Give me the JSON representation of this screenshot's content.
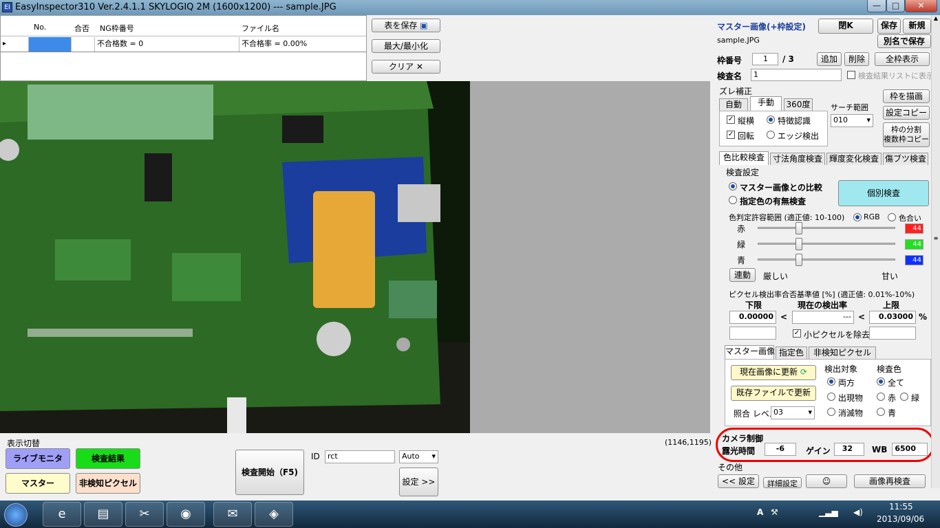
{
  "window": {
    "title": "EasyInspector310 Ver.2.4.1.1 SKYLOGIQ 2M    (1600x1200) --- sample.JPG",
    "icon_text": "EI",
    "minimize": "—",
    "maximize": "□",
    "close": "✕"
  },
  "grid": {
    "headers": [
      "No.",
      "合否",
      "NG枠番号",
      "ファイル名"
    ],
    "row": {
      "marker": "▸",
      "c2": "不合格数 = 0",
      "c3": "不合格率 = 0.00%"
    }
  },
  "buttons": {
    "save_table": "表を保存",
    "maxmin": "最大/最小化",
    "clear": "クリア"
  },
  "status": {
    "coords": "(1146,1195)"
  },
  "display_switch": {
    "label": "表示切替",
    "live": "ライブモニタ",
    "result": "検査結果",
    "master": "マスター",
    "undetected": "非検知ピクセル"
  },
  "inspect": {
    "start": "検査開始（F5)",
    "id_label": "ID",
    "id_value": "rct",
    "mode": "Auto",
    "settings": "設定 >>"
  },
  "right": {
    "header": "マスター画像(+枠設定)",
    "close": "閉K",
    "save": "保存",
    "new": "新規",
    "filename": "sample.JPG",
    "save_as": "別名で保存",
    "frame_no_label": "枠番号",
    "frame_no": "1",
    "frame_total": "/ 3",
    "add": "追加",
    "delete": "削除",
    "show_all": "全枠表示",
    "inspect_name_label": "検査名",
    "inspect_name": "1",
    "show_in_list": "検査結果リストに表示",
    "shift": {
      "label": "ズレ補正",
      "tabs": [
        "自動",
        "手動",
        "360度"
      ],
      "search_label": "サーチ範囲",
      "search_value": "010",
      "vh": "縦横",
      "rot": "回転",
      "feature": "特徴認識",
      "edge": "エッジ検出"
    },
    "draw_frame": "枠を描画",
    "copy_settings": "設定コピー",
    "split_1": "枠の分割",
    "split_2": "複数枠コピー",
    "insp_tabs": [
      "色比較検査",
      "寸法角度検査",
      "輝度変化検査",
      "傷ブツ検査"
    ],
    "insp_settings": "検査設定",
    "compare_master": "マスター画像との比較",
    "color_presence": "指定色の有無検査",
    "individual": "個別検査",
    "tolerance_label": "色判定許容範囲 (適正値: 10-100)",
    "rgb": "RGB",
    "hue": "色合い",
    "colors": [
      {
        "label": "赤",
        "value": "44",
        "hex": "#ff2020",
        "level": 0.3
      },
      {
        "label": "緑",
        "value": "44",
        "hex": "#20e020",
        "level": 0.3
      },
      {
        "label": "青",
        "value": "44",
        "hex": "#1030ff",
        "level": 0.3
      }
    ],
    "link": "連動",
    "strict": "厳しい",
    "loose": "甘い",
    "pixel_label": "ピクセル検出率合否基準値 [%] (適正値: 0.01%-10%)",
    "lower": "下限",
    "current": "現在の検出率",
    "upper": "上限",
    "lower_val": "0.00000",
    "current_val": "---",
    "upper_val": "0.03000",
    "lt": "<",
    "pct": "%",
    "remove_small": "小ピクセルを除去",
    "sub_tabs": [
      "マスター画像",
      "指定色",
      "非検知ピクセル"
    ],
    "update_current": "現在画像に更新",
    "update_file": "既存ファイルで更新",
    "match_label": "照合 レベル",
    "match_value": "03",
    "target_label": "検出対象",
    "both": "両方",
    "appear": "出現物",
    "vanish": "消滅物",
    "color_label": "検査色",
    "all": "全て",
    "red": "赤",
    "green": "緑",
    "blue": "青",
    "camera": {
      "label": "カメラ制御",
      "exposure_label": "露光時間",
      "exposure": "-6",
      "gain_label": "ゲイン",
      "gain": "32",
      "wb_label": "WB",
      "wb": "6500"
    },
    "other": "その他",
    "settings_back": "<< 設定",
    "detail": "詳細設定",
    "reinspect": "画像再検査"
  },
  "taskbar": {
    "time": "11:55",
    "date": "2013/09/06",
    "ime": "A"
  }
}
